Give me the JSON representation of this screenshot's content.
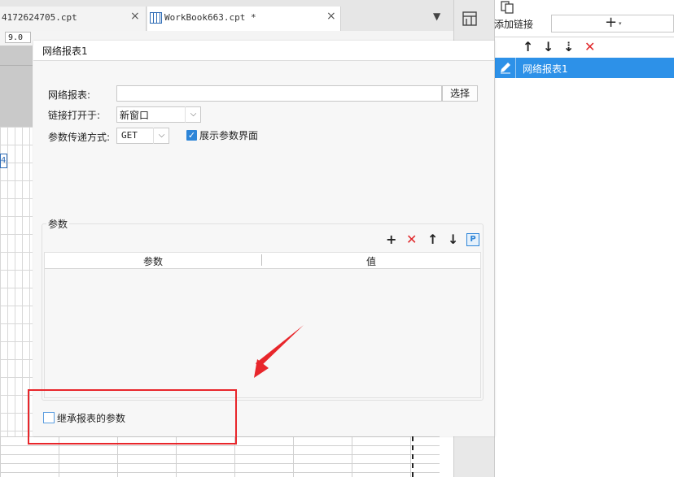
{
  "tabs": [
    {
      "label": "4172624705.cpt",
      "close": "×"
    },
    {
      "label": "WorkBook663.cpt *",
      "close": "×"
    }
  ],
  "toolbar": {
    "font_size": "9.0"
  },
  "sheet": {
    "cell_text": "4"
  },
  "right_panel": {
    "add_link_label": "添加链接",
    "add_link_symbol": "+",
    "add_link_caret": "▾",
    "buttons": {
      "copy": "copy-icon",
      "up": "↑",
      "down": "↓",
      "sort": "⇣",
      "delete": "✕"
    },
    "links": [
      {
        "label": "网络报表1"
      }
    ]
  },
  "dialog": {
    "title": "网络报表1",
    "report_label": "网络报表:",
    "report_value": "",
    "select_button": "选择",
    "open_in_label": "链接打开于:",
    "open_in_value": "新窗口",
    "param_mode_label": "参数传递方式:",
    "param_mode_value": "GET",
    "show_params_label": "展示参数界面",
    "show_params_checked": true,
    "params_group": {
      "legend": "参数",
      "toolbar": {
        "add": "+",
        "delete": "✕",
        "up": "↑",
        "down": "↓",
        "p": "P"
      },
      "columns": [
        "参数",
        "值"
      ],
      "rows": []
    },
    "inherit_label": "继承报表的参数",
    "inherit_checked": false
  },
  "colors": {
    "accent": "#2d91e8",
    "delete": "#e0282b",
    "annotation": "#e8262b"
  }
}
